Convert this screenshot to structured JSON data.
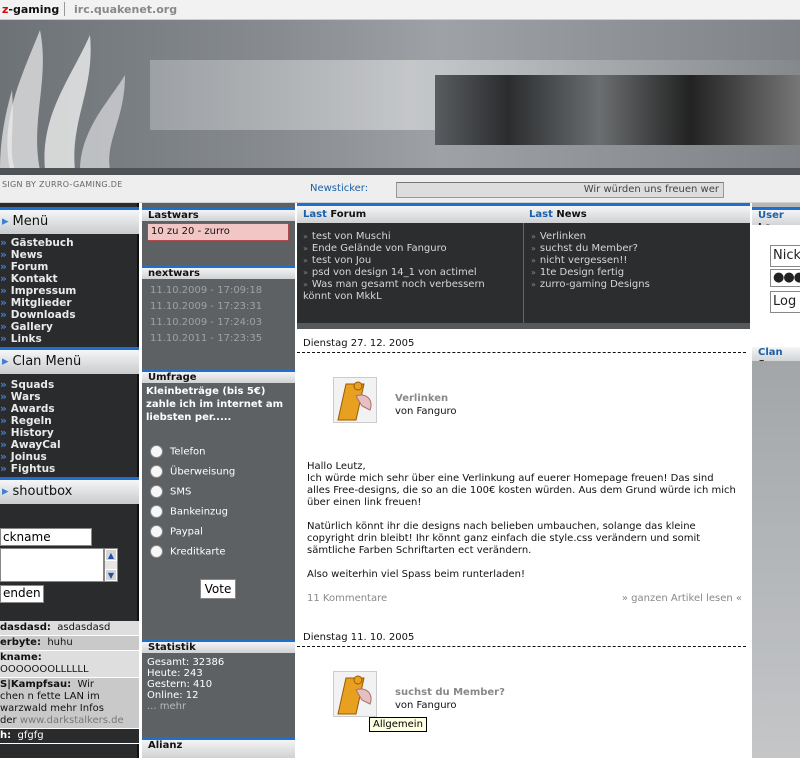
{
  "topbar": {
    "site_prefix": "z",
    "site_name": "-gaming",
    "irc": "irc.quakenet.org"
  },
  "subbar": {
    "design_credit": "SIGN BY ZURRO-GAMING.DE",
    "newsticker_label": "Newsticker:",
    "ticker_text": "Wir würden uns freuen wer"
  },
  "left": {
    "menu_title": "Menü",
    "menu_items": [
      "Gästebuch",
      "News",
      "Forum",
      "Kontakt",
      "Impressum",
      "Mitglieder",
      "Downloads",
      "Gallery",
      "Links"
    ],
    "clan_title": "Clan Menü",
    "clan_items": [
      "Squads",
      "Wars",
      "Awards",
      "Regeln",
      "History",
      "AwayCal",
      "Joinus",
      "Fightus"
    ],
    "shout_title": "shoutbox",
    "shout_name_value": "ckname",
    "shout_send_label": "enden",
    "scroll_up": "▲",
    "scroll_down": "▼",
    "shouts": [
      {
        "name": "dasdasd:",
        "text": "asdasdasd"
      },
      {
        "name": "erbyte:",
        "text": "huhu"
      },
      {
        "name": "kname:",
        "text": "OOOOOOOLLLLLL"
      },
      {
        "name": "S|Kampfsau:",
        "text": "Wir",
        "extra": "chen n fette LAN im",
        "extra2": "warzwald mehr Infos",
        "extra3": "der",
        "link": "www.darkstalkers.de"
      },
      {
        "name": "h:",
        "text": "gfgfg"
      }
    ]
  },
  "mid": {
    "lastwars_title": "Lastwars",
    "lastwar_result": "10 zu 20 - zurro",
    "nextwars_title": "nextwars",
    "nextwars": [
      "11.10.2009 - 17:09:18",
      "11.10.2009 - 17:23:31",
      "11.10.2009 - 17:24:03",
      "11.10.2011 - 17:23:35"
    ],
    "poll_title": "Umfrage",
    "poll_question": "Kleinbeträge (bis 5€) zahle ich im internet am liebsten per.....",
    "poll_options": [
      "Telefon",
      "Überweisung",
      "SMS",
      "Bankeinzug",
      "Paypal",
      "Kreditkarte"
    ],
    "vote_label": "Vote",
    "stats_title": "Statistik",
    "stats": [
      "Gesamt: 32386",
      "Heute: 243",
      "Gestern: 410",
      "Online: 12"
    ],
    "stats_more": "... mehr",
    "allianz_title": "Alianz"
  },
  "center": {
    "forum_tab_hl": "Last",
    "forum_tab": "Forum",
    "news_tab_hl": "Last",
    "news_tab": "News",
    "forum_items": [
      "test von Muschi",
      "Ende Gelände von Fanguro",
      "test von Jou",
      "psd von design 14_1 von actimel",
      "Was man gesamt noch verbessern"
    ],
    "forum_wrap": "könnt von MkkL",
    "news_items": [
      "Verlinken",
      "suchst du Member?",
      "nicht vergessen!!",
      "1te Design fertig",
      "zurro-gaming Designs"
    ],
    "articles": [
      {
        "date": "Dienstag 27. 12. 2005",
        "title": "Verlinken",
        "author": "von Fanguro",
        "paragraphs": [
          "Hallo Leutz,\nIch würde mich sehr über eine Verlinkung auf euerer Homepage freuen! Das sind alles Free-designs, die so an die 100€ kosten würden. Aus dem Grund würde ich mich über einen link freuen!",
          "Natürlich könnt ihr die designs nach belieben umbauchen, solange das kleine copyright drin bleibt! Ihr könnt ganz einfach die style.css verändern und somit sämtliche Farben Schriftarten ect verändern.",
          "Also weiterhin viel Spass beim runterladen!"
        ],
        "comments": "11 Kommentare",
        "read_more": "» ganzen Artikel lesen «"
      },
      {
        "date": "Dienstag 11. 10. 2005",
        "title": "suchst du Member?",
        "author": "von Fanguro",
        "tooltip": "Allgemein"
      }
    ]
  },
  "right": {
    "head1_hl": "User",
    "head1": "Lo",
    "nick_value": "Nick",
    "pass_value": "●●●●",
    "login_label": "Log",
    "head2_hl": "Clan",
    "head2": "Sp"
  },
  "colors": {
    "accent": "#1f6fd1",
    "link": "#1b5fa8",
    "dark": "#2a2b2c"
  }
}
